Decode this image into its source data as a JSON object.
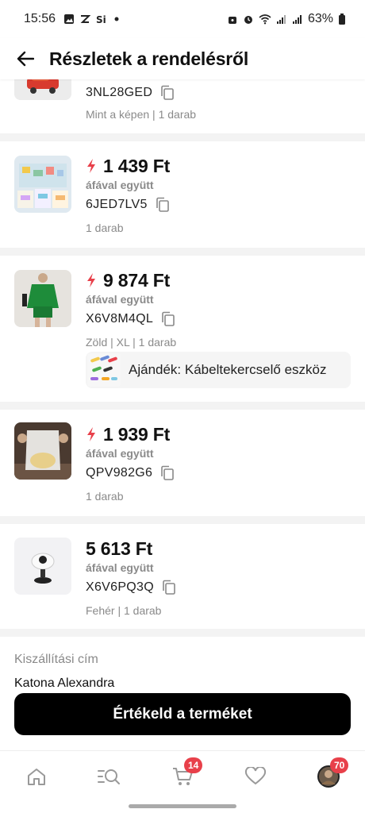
{
  "status": {
    "time": "15:56",
    "battery": "63%"
  },
  "header": {
    "title": "Részletek a rendelésről"
  },
  "orders": [
    {
      "sku": "3NL28GED",
      "meta": "Mint a képen | 1 darab"
    },
    {
      "price": "1 439 Ft",
      "vat": "áfával együtt",
      "sku": "6JED7LV5",
      "meta": "1 darab",
      "flash": true
    },
    {
      "price": "9 874 Ft",
      "vat": "áfával együtt",
      "sku": "X6V8M4QL",
      "meta": "Zöld | XL | 1 darab",
      "flash": true,
      "gift": "Ajándék: Kábeltekercselő eszköz"
    },
    {
      "price": "1 939 Ft",
      "vat": "áfával együtt",
      "sku": "QPV982G6",
      "meta": "1 darab",
      "flash": true
    },
    {
      "price": "5 613 Ft",
      "vat": "áfával együtt",
      "sku": "X6V6PQ3Q",
      "meta": "Fehér | 1 darab",
      "flash": false
    }
  ],
  "address": {
    "label": "Kiszállítási cím",
    "name": "Katona Alexandra"
  },
  "cta": {
    "label": "Értékeld a terméket"
  },
  "tabbar": {
    "cart_badge": "14",
    "profile_badge": "70"
  },
  "colors": {
    "accent": "#e8404a",
    "cta_bg": "#000000",
    "flash": "#e8404a"
  }
}
